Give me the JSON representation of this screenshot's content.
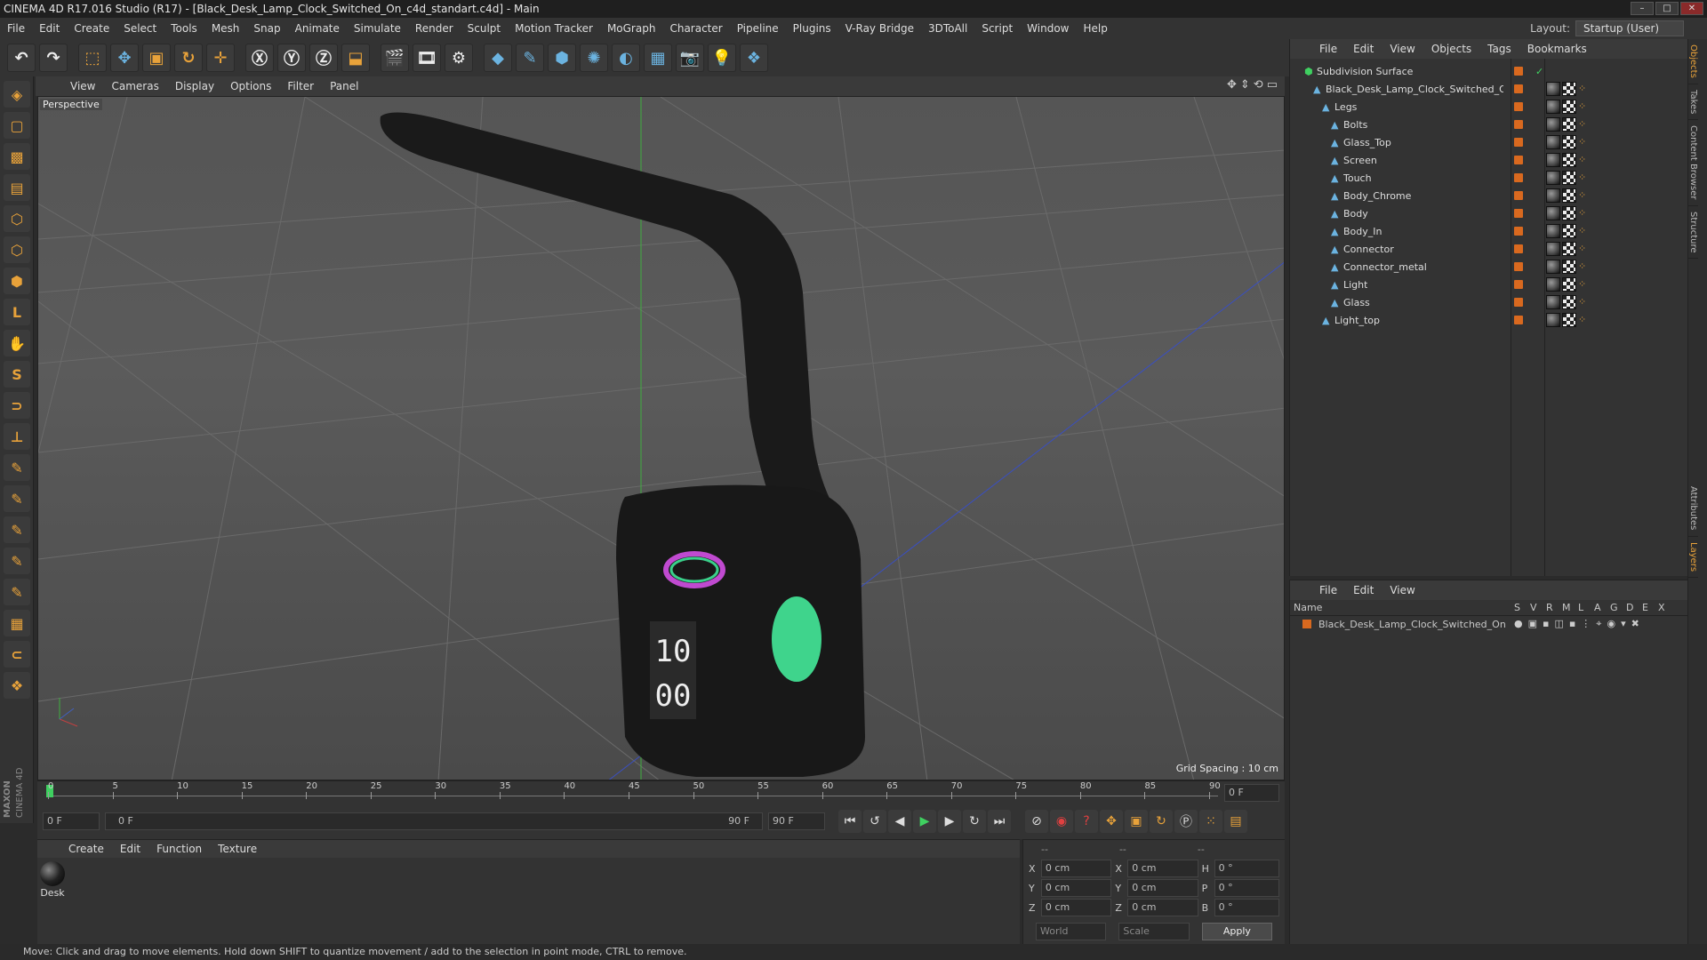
{
  "window": {
    "title": "CINEMA 4D R17.016 Studio (R17) - [Black_Desk_Lamp_Clock_Switched_On_c4d_standart.c4d] - Main"
  },
  "menubar": {
    "items": [
      "File",
      "Edit",
      "Create",
      "Select",
      "Tools",
      "Mesh",
      "Snap",
      "Animate",
      "Simulate",
      "Render",
      "Sculpt",
      "Motion Tracker",
      "MoGraph",
      "Character",
      "Pipeline",
      "Plugins",
      "V-Ray Bridge",
      "3DToAll",
      "Script",
      "Window",
      "Help"
    ],
    "layout_label": "Layout:",
    "layout_value": "Startup (User)"
  },
  "viewport": {
    "menu": [
      "View",
      "Cameras",
      "Display",
      "Options",
      "Filter",
      "Panel"
    ],
    "label": "Perspective",
    "grid_spacing": "Grid Spacing : 10 cm",
    "clock_top": "10",
    "clock_bottom": "00"
  },
  "timeline": {
    "ticks": [
      "0",
      "5",
      "10",
      "15",
      "20",
      "25",
      "30",
      "35",
      "40",
      "45",
      "50",
      "55",
      "60",
      "65",
      "70",
      "75",
      "80",
      "85",
      "90"
    ],
    "current_frame_field": "0 F",
    "start_field": "0 F",
    "range_start": "0 F",
    "range_end": "90 F",
    "end_field": "90 F"
  },
  "materials": {
    "menu": [
      "Create",
      "Edit",
      "Function",
      "Texture"
    ],
    "items": [
      {
        "name": "Desk"
      }
    ]
  },
  "coords": {
    "header": [
      "--",
      "--",
      "--"
    ],
    "rows": [
      {
        "a": "X",
        "av": "0 cm",
        "b": "X",
        "bv": "0 cm",
        "c": "H",
        "cv": "0 °"
      },
      {
        "a": "Y",
        "av": "0 cm",
        "b": "Y",
        "bv": "0 cm",
        "c": "P",
        "cv": "0 °"
      },
      {
        "a": "Z",
        "av": "0 cm",
        "b": "Z",
        "bv": "0 cm",
        "c": "B",
        "cv": "0 °"
      }
    ],
    "space": "World",
    "mode": "Scale",
    "apply": "Apply"
  },
  "object_manager": {
    "menu": [
      "File",
      "Edit",
      "View",
      "Objects",
      "Tags",
      "Bookmarks"
    ],
    "objects": [
      {
        "name": "Subdivision Surface",
        "depth": 0
      },
      {
        "name": "Black_Desk_Lamp_Clock_Switched_On",
        "depth": 1
      },
      {
        "name": "Legs",
        "depth": 2
      },
      {
        "name": "Bolts",
        "depth": 3
      },
      {
        "name": "Glass_Top",
        "depth": 3
      },
      {
        "name": "Screen",
        "depth": 3
      },
      {
        "name": "Touch",
        "depth": 3
      },
      {
        "name": "Body_Chrome",
        "depth": 3
      },
      {
        "name": "Body",
        "depth": 3
      },
      {
        "name": "Body_In",
        "depth": 3
      },
      {
        "name": "Connector",
        "depth": 3
      },
      {
        "name": "Connector_metal",
        "depth": 3
      },
      {
        "name": "Light",
        "depth": 3
      },
      {
        "name": "Glass",
        "depth": 3
      },
      {
        "name": "Light_top",
        "depth": 2
      }
    ]
  },
  "layer_manager": {
    "menu": [
      "File",
      "Edit",
      "View"
    ],
    "columns": [
      "Name",
      "S",
      "V",
      "R",
      "M",
      "L",
      "A",
      "G",
      "D",
      "E",
      "X"
    ],
    "layers": [
      {
        "name": "Black_Desk_Lamp_Clock_Switched_On"
      }
    ]
  },
  "side_tabs": [
    "Objects",
    "Takes",
    "Content Browser",
    "Structure",
    "Attributes",
    "Layers"
  ],
  "status": {
    "text": "Move: Click and drag to move elements. Hold down SHIFT to quantize movement / add to the selection in point mode, CTRL to remove."
  },
  "brand": {
    "line1": "MAXON",
    "line2": "CINEMA 4D"
  },
  "colors": {
    "accent": "#e8a23a",
    "object_tag": "#d9691f",
    "viewport_bg": "#585858"
  }
}
